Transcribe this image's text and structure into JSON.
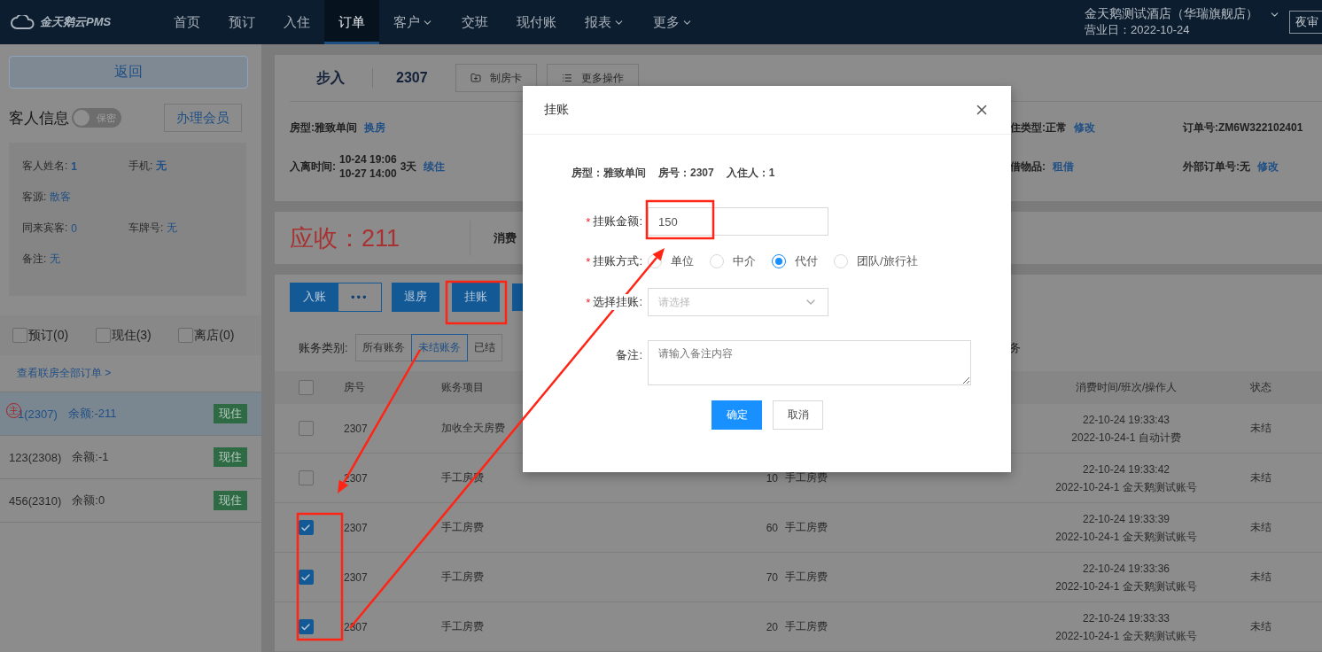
{
  "nav": {
    "logo": "金天鹅云PMS",
    "items": [
      {
        "label": "首页",
        "selected": false,
        "has_menu": false
      },
      {
        "label": "预订",
        "selected": false,
        "has_menu": false
      },
      {
        "label": "入住",
        "selected": false,
        "has_menu": false
      },
      {
        "label": "订单",
        "selected": true,
        "has_menu": false
      },
      {
        "label": "客户",
        "selected": false,
        "has_menu": true
      },
      {
        "label": "交班",
        "selected": false,
        "has_menu": false
      },
      {
        "label": "现付账",
        "selected": false,
        "has_menu": false
      },
      {
        "label": "报表",
        "selected": false,
        "has_menu": true
      },
      {
        "label": "更多",
        "selected": false,
        "has_menu": true
      }
    ],
    "hotel": "金天鹅测试酒店（华瑞旗舰店）",
    "business_day": "营业日：2022-10-24",
    "night_audit": "夜审"
  },
  "sidebar": {
    "back": "返回",
    "guest_title": "客人信息",
    "privacy_toggle": {
      "label": "保密",
      "on": false
    },
    "member_button": "办理会员",
    "fields": [
      {
        "label": "客人姓名:",
        "value": "1",
        "bold": true
      },
      {
        "label": "手机:",
        "value": "无",
        "bold": true
      },
      {
        "label": "客源:",
        "value": "散客",
        "bold": false
      },
      {
        "label": "同来宾客:",
        "value": "0",
        "bold": false
      },
      {
        "label": "车牌号:",
        "value": "无",
        "bold": false
      },
      {
        "label": "备注:",
        "value": "无",
        "bold": false
      }
    ],
    "filters": [
      {
        "label": "预订(0)",
        "checked": false
      },
      {
        "label": "现住(3)",
        "checked": false
      },
      {
        "label": "离店(0)",
        "checked": false
      }
    ],
    "link": "查看联房全部订单 >",
    "rooms": [
      {
        "name": "1(2307)",
        "balance": "余额:-211",
        "tag": "现住",
        "main": true,
        "main_label": "主",
        "selected": true
      },
      {
        "name": "123(2308)",
        "balance": "余额:-1",
        "tag": "现住",
        "main": false,
        "selected": false
      },
      {
        "name": "456(2310)",
        "balance": "余额:0",
        "tag": "现住",
        "main": false,
        "selected": false
      }
    ]
  },
  "order": {
    "source": "步入",
    "room": "2307",
    "actions": [
      "制房卡",
      "更多操作"
    ],
    "info_left": [
      {
        "label": "房型:",
        "value": "雅致单间",
        "link": "换房"
      }
    ],
    "stay": {
      "label": "入离时间:",
      "arrive": "10-24 19:06",
      "leave": "10-27 14:00",
      "nights": "3天",
      "link": "续住"
    },
    "info_mid": [
      {
        "label": "住类型:",
        "value": "正常",
        "link": "修改"
      },
      {
        "label": "借物品:",
        "link": "租借"
      }
    ],
    "info_right": [
      {
        "label": "订单号:",
        "value": "ZM6W322102401"
      },
      {
        "label": "外部订单号:",
        "value": "无",
        "link": "修改"
      }
    ],
    "receivable": "应收：211",
    "consumed": "消费"
  },
  "bill": {
    "buttons": [
      "入账",
      "•••",
      "退房",
      "挂账"
    ],
    "category_label": "账务类别:",
    "categories": [
      {
        "label": "所有账务",
        "selected": false
      },
      {
        "label": "未结账务",
        "selected": true
      },
      {
        "label": "已结",
        "selected": false
      }
    ],
    "category_tail": "务",
    "header": {
      "checked": false,
      "room": "房号",
      "item": "账务项目",
      "time": "消费时间/班次/操作人",
      "status": "状态"
    },
    "rows": [
      {
        "checked": false,
        "room": "2307",
        "item": "加收全天房费",
        "time": "22-10-24 19:33:43",
        "shift": "2022-10-24-1 自动计费",
        "status": "未结"
      },
      {
        "checked": false,
        "room": "2307",
        "item": "手工房费",
        "column_4": "10",
        "column_5": "手工房费",
        "time": "22-10-24 19:33:42",
        "shift": "2022-10-24-1 金天鹅测试账号",
        "status": "未结"
      },
      {
        "checked": true,
        "room": "2307",
        "item": "手工房费",
        "column_4": "60",
        "column_5": "手工房费",
        "time": "22-10-24 19:33:39",
        "shift": "2022-10-24-1 金天鹅测试账号",
        "status": "未结"
      },
      {
        "checked": true,
        "room": "2307",
        "item": "手工房费",
        "column_4": "70",
        "column_5": "手工房费",
        "time": "22-10-24 19:33:36",
        "shift": "2022-10-24-1 金天鹅测试账号",
        "status": "未结"
      },
      {
        "checked": true,
        "room": "2307",
        "item": "手工房费",
        "column_4": "20",
        "column_5": "手工房费",
        "time": "22-10-24 19:33:33",
        "shift": "2022-10-24-1 金天鹅测试账号",
        "status": "未结"
      }
    ]
  },
  "dialog": {
    "title": "挂账",
    "info": [
      "房型：雅致单间",
      "房号：2307",
      "入住人：1"
    ],
    "amount": {
      "label": "挂账金额:",
      "required_mark": "*",
      "value": "150"
    },
    "method": {
      "label": "挂账方式:",
      "required_mark": "*",
      "options": [
        {
          "label": "单位",
          "selected": false
        },
        {
          "label": "中介",
          "selected": false
        },
        {
          "label": "代付",
          "selected": true
        },
        {
          "label": "团队/旅行社",
          "selected": false
        }
      ]
    },
    "account": {
      "label": "选择挂账:",
      "required_mark": "*",
      "placeholder": "请选择"
    },
    "note": {
      "label": "备注:",
      "placeholder": "请输入备注内容"
    },
    "buttons": [
      "确定",
      "取消"
    ]
  }
}
